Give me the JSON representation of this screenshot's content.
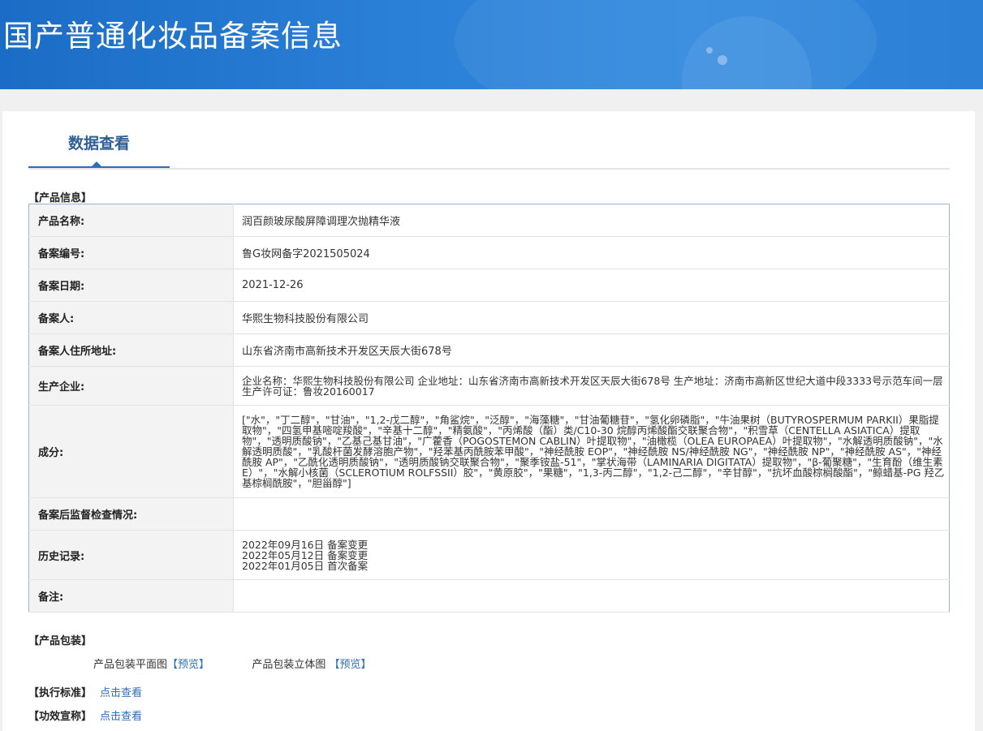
{
  "header": {
    "title": "国产普通化妆品备案信息"
  },
  "tabs": [
    {
      "label": "数据查看"
    }
  ],
  "product_section": {
    "title": "【产品信息】"
  },
  "fields": [
    {
      "label": "产品名称:",
      "value": "润百颜玻尿酸屏障调理次抛精华液"
    },
    {
      "label": "备案编号:",
      "value": "鲁G妆网备字2021505024"
    },
    {
      "label": "备案日期:",
      "value": "2021-12-26"
    },
    {
      "label": "备案人:",
      "value": "华熙生物科技股份有限公司"
    },
    {
      "label": "备案人住所地址:",
      "value": "山东省济南市高新技术开发区天辰大街678号"
    },
    {
      "label": "生产企业:",
      "value": "企业名称：华熙生物科技股份有限公司 企业地址：山东省济南市高新技术开发区天辰大街678号 生产地址：济南市高新区世纪大道中段3333号示范车间一层 生产许可证：鲁妆20160017"
    },
    {
      "label": "成分:",
      "value": "[\"水\"，\"丁二醇\"，\"甘油\"，\"1,2-戊二醇\"，\"角鲨烷\"，\"泛醇\"，\"海藻糖\"，\"甘油葡糖苷\"，\"氢化卵磷脂\"，\"牛油果树（BUTYROSPERMUM PARKII）果脂提取物\"，\"四氢甲基嘧啶羧酸\"，\"辛基十二醇\"，\"精氨酸\"，\"丙烯酸（酯）类/C10-30 烷醇丙烯酸酯交联聚合物\"，\"积雪草（CENTELLA ASIATICA）提取物\"，\"透明质酸钠\"，\"乙基己基甘油\"，\"广藿香（POGOSTEMON CABLIN）叶提取物\"，\"油橄榄（OLEA EUROPAEA）叶提取物\"，\"水解透明质酸钠\"，\"水解透明质酸\"，\"乳酸杆菌发酵溶胞产物\"，\"羟苯基丙酰胺苯甲酸\"，\"神经酰胺 EOP\"，\"神经酰胺 NS/神经酰胺 NG\"，\"神经酰胺 NP\"，\"神经酰胺 AS\"，\"神经酰胺 AP\"，\"乙酰化透明质酸钠\"，\"透明质酸钠交联聚合物\"，\"聚季铵盐-51\"，\"掌状海带（LAMINARIA DIGITATA）提取物\"，\"β-葡聚糖\"，\"生育酚（维生素E）\"，\"水解小核菌（SCLEROTIUM ROLFSSII）胶\"，\"黄原胶\"，\"果糖\"，\"1,3-丙二醇\"，\"1,2-己二醇\"，\"辛甘醇\"，\"抗坏血酸棕榈酸酯\"，\"鲸蜡基-PG 羟乙基棕榈酰胺\"，\"胆甾醇\"]"
    },
    {
      "label": "备案后监督检查情况:",
      "value": ""
    },
    {
      "label": "历史记录:",
      "lines": [
        "2022年09月16日 备案变更",
        "2022年05月12日 备案变更",
        "2022年01月05日 首次备案"
      ]
    },
    {
      "label": "备注:",
      "value": ""
    }
  ],
  "packaging": {
    "title": "【产品包装】",
    "flat_label": "产品包装平面图",
    "flat_preview": "【预览】",
    "solid_label": "产品包装立体图",
    "solid_preview": "【预览】"
  },
  "standard": {
    "title": "【执行标准】",
    "link": "点击查看"
  },
  "efficacy": {
    "title": "【功效宣称】",
    "link": "点击查看"
  },
  "colors": {
    "banner": "#2a7fd6",
    "accent": "#2a6fb8",
    "label_bg": "#f3f3f3",
    "table_border": "#9ab4d6"
  }
}
